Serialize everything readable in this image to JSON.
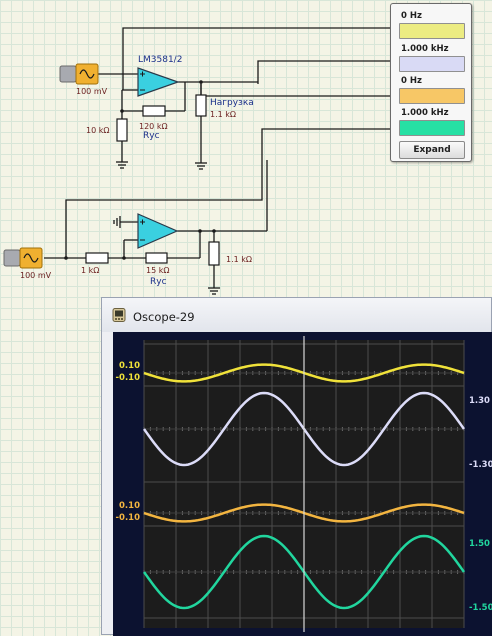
{
  "schematic": {
    "source1_amplitude": "100 mV",
    "source2_amplitude": "100 mV",
    "opamp_label": "LM3581/2",
    "load_label": "Нагрузка",
    "load_value": "1.1 kΩ",
    "r_ground_value": "10 kΩ",
    "r_feedback1_value": "120 kΩ",
    "r_feedback1_label": "Rус",
    "r_input2_value": "1 kΩ",
    "r_feedback2_value": "15 kΩ",
    "r_feedback2_label": "Rус",
    "load2_value": "1.1 kΩ"
  },
  "meter": {
    "channels": [
      {
        "label": "0 Hz",
        "color": "#ecec82"
      },
      {
        "label": "1.000 kHz",
        "color": "#d9daf5"
      },
      {
        "label": "0 Hz",
        "color": "#f7c766"
      },
      {
        "label": "1.000 kHz",
        "color": "#26e0a4"
      }
    ],
    "expand_label": "Expand"
  },
  "oscope": {
    "title": "Oscope-29",
    "background_color": "#0c1230",
    "traces": [
      {
        "color": "#f0e23a",
        "upper": "0.10",
        "lower": "-0.10",
        "side": "left",
        "amplitude": 0.3
      },
      {
        "color": "#dcdcf8",
        "upper": "1.30",
        "lower": "-1.30",
        "side": "right",
        "amplitude": 1.0
      },
      {
        "color": "#f3b540",
        "upper": "0.10",
        "lower": "-0.10",
        "side": "left",
        "amplitude": 0.3
      },
      {
        "color": "#21d69e",
        "upper": "1.50",
        "lower": "-1.50",
        "side": "right",
        "amplitude": 1.0
      }
    ]
  }
}
